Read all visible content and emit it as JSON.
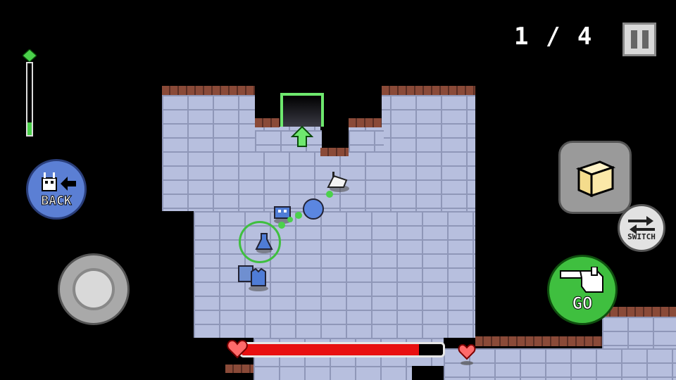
{
  "hud": {
    "counter": "1 / 4",
    "back_label": "BACK",
    "switch_label": "SWITCH",
    "go_label": "GO",
    "health_percent": 88,
    "energy_percent": 18
  },
  "colors": {
    "floor": "#b7bfde",
    "health": "#e81010",
    "go_button": "#3fbf3f",
    "back_button": "#5b7fd4",
    "exit_marker": "#6ee86e"
  },
  "icons": {
    "pause": "pause-icon",
    "back": "robot-back-icon",
    "switch": "switch-arrows-icon",
    "go": "pointing-hand-icon",
    "item": "crate-icon",
    "heart": "heart-icon",
    "exit_arrow": "up-arrow-icon"
  }
}
